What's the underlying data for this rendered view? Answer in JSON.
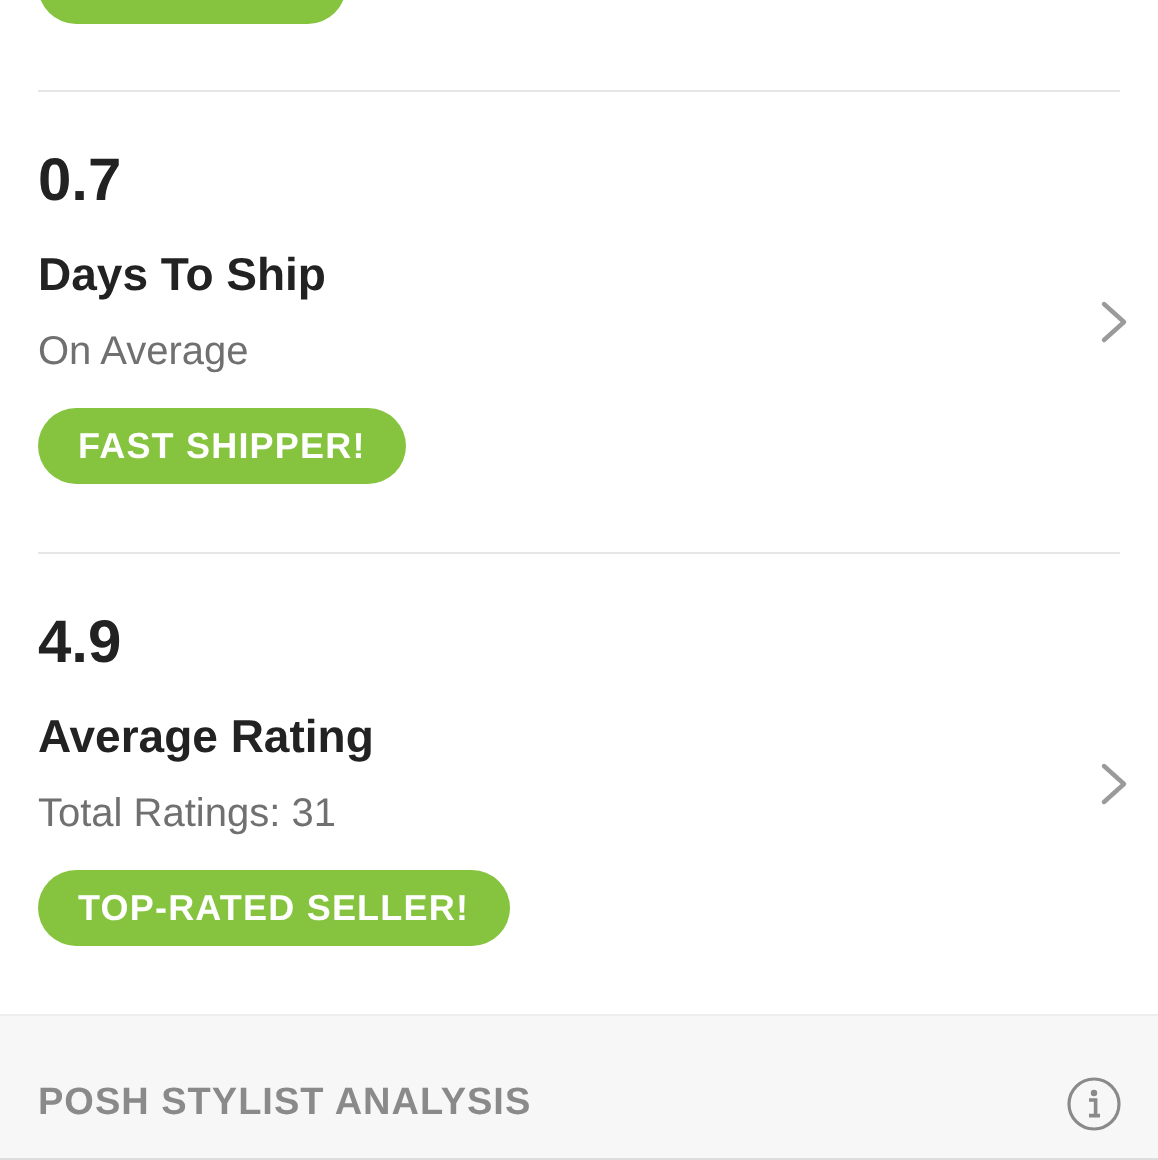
{
  "stats": [
    {
      "value": "0.7",
      "title": "Days To Ship",
      "subtitle": "On Average",
      "badge": "FAST SHIPPER!"
    },
    {
      "value": "4.9",
      "title": "Average Rating",
      "subtitle": "Total Ratings: 31",
      "badge": "TOP-RATED SELLER!"
    }
  ],
  "analysis": {
    "title": "POSH STYLIST ANALYSIS"
  }
}
